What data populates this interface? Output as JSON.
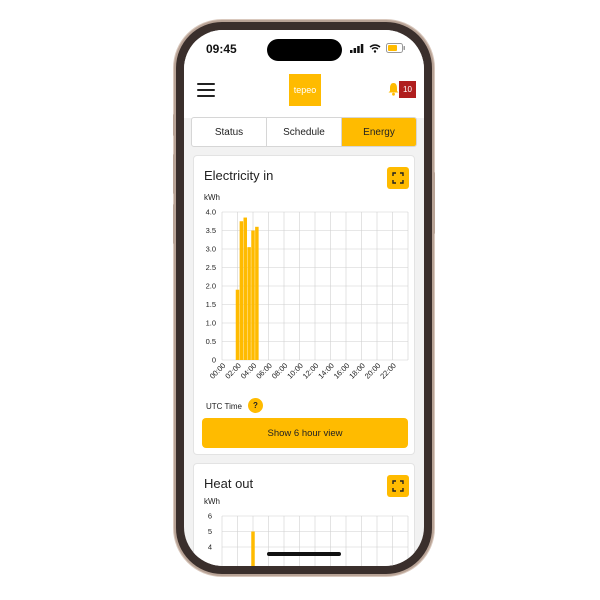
{
  "status_bar": {
    "time": "09:45"
  },
  "header": {
    "logo_text": "tepeo",
    "notification_count": "10"
  },
  "tabs": [
    {
      "label": "Status",
      "active": false
    },
    {
      "label": "Schedule",
      "active": false
    },
    {
      "label": "Energy",
      "active": true
    }
  ],
  "electricity": {
    "title": "Electricity in",
    "unit": "kWh",
    "utc_label": "UTC Time",
    "help_symbol": "?",
    "show_button": "Show 6 hour view"
  },
  "heat": {
    "title": "Heat out",
    "unit": "kWh"
  },
  "colors": {
    "accent": "#ffbb00",
    "badge": "#b01e1e",
    "grid": "#d0d0d0"
  },
  "chart_data": [
    {
      "type": "bar",
      "title": "Electricity in",
      "ylabel": "kWh",
      "xlabel": "UTC Time",
      "ylim": [
        0,
        4.0
      ],
      "yticks": [
        "0",
        "0.5",
        "1.0",
        "1.5",
        "2.0",
        "2.5",
        "3.0",
        "3.5",
        "4.0"
      ],
      "xticks": [
        "00:00",
        "02:00",
        "04:00",
        "06:00",
        "08:00",
        "10:00",
        "12:00",
        "14:00",
        "16:00",
        "18:00",
        "20:00",
        "22:00"
      ],
      "x": [
        2.0,
        2.5,
        3.0,
        3.5,
        4.0,
        4.5,
        5.0,
        5.5
      ],
      "values": [
        1.9,
        3.75,
        3.85,
        3.05,
        3.5,
        3.6,
        0,
        0
      ],
      "grid": true
    },
    {
      "type": "bar",
      "title": "Heat out",
      "ylabel": "kWh",
      "ylim": [
        0,
        6
      ],
      "yticks": [
        "4",
        "5",
        "6"
      ],
      "x": [
        4.0
      ],
      "values": [
        5.0
      ],
      "grid": true
    }
  ]
}
